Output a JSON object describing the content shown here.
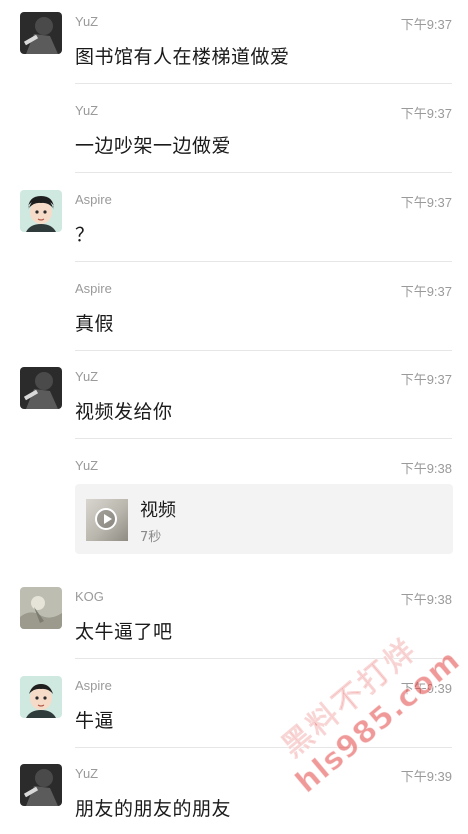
{
  "messages": [
    {
      "sender": "YuZ",
      "time": "下午9:37",
      "text": "图书馆有人在楼梯道做爱",
      "avatar": "yuz-avatar"
    },
    {
      "sender": "YuZ",
      "time": "下午9:37",
      "text": "一边吵架一边做爱",
      "avatar": null
    },
    {
      "sender": "Aspire",
      "time": "下午9:37",
      "text": "？",
      "avatar": "aspire-avatar"
    },
    {
      "sender": "Aspire",
      "time": "下午9:37",
      "text": "真假",
      "avatar": null
    },
    {
      "sender": "YuZ",
      "time": "下午9:37",
      "text": "视频发给你",
      "avatar": "yuz-avatar"
    },
    {
      "sender": "YuZ",
      "time": "下午9:38",
      "video": {
        "title": "视频",
        "duration": "7秒"
      },
      "avatar": null
    },
    {
      "sender": "KOG",
      "time": "下午9:38",
      "text": "太牛逼了吧",
      "avatar": "kog-avatar"
    },
    {
      "sender": "Aspire",
      "time": "下午9:39",
      "text": "牛逼",
      "avatar": "aspire-avatar"
    },
    {
      "sender": "YuZ",
      "time": "下午9:39",
      "text": "朋友的朋友的朋友",
      "avatar": "yuz-avatar"
    }
  ],
  "watermark": {
    "line1": "黑料不打烊",
    "line2": "hls985.com"
  },
  "colors": {
    "sender": "#9a9a9a",
    "text": "#1a1a1a",
    "divider": "#e6e6e6",
    "watermark": "#e44646"
  }
}
